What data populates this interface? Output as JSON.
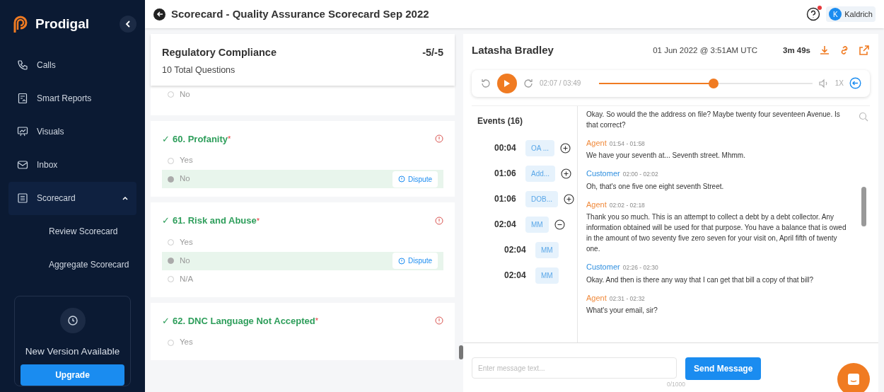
{
  "sidebar": {
    "brand": "Prodigal",
    "items": [
      {
        "kind": "phone",
        "label": "Calls",
        "selected": false
      },
      {
        "kind": "report",
        "label": "Smart Reports",
        "selected": false
      },
      {
        "kind": "chart",
        "label": "Visuals",
        "selected": false
      },
      {
        "kind": "mail",
        "label": "Inbox",
        "selected": false
      },
      {
        "kind": "list",
        "label": "Scorecard",
        "selected": true,
        "expanded": true,
        "children": [
          {
            "label": "Review Scorecard"
          },
          {
            "label": "Aggregate Scorecard"
          }
        ]
      }
    ],
    "update": {
      "text": "New Version Available",
      "button": "Upgrade"
    }
  },
  "topbar": {
    "title": "Scorecard - Quality Assurance Scorecard Sep 2022",
    "user": {
      "initial": "K",
      "name": "Kaldrich"
    },
    "help_notification": true
  },
  "section": {
    "title": "Regulatory Compliance",
    "subtitle": "10 Total Questions",
    "score": "-5/-5"
  },
  "questions": [
    {
      "options": [
        {
          "label": "No",
          "selected": false
        }
      ]
    },
    {
      "title": "60. Profanity",
      "check_mark": "✓",
      "required_mark": "*",
      "options": [
        {
          "label": "Yes",
          "selected": false
        },
        {
          "label": "No",
          "selected": true,
          "action": "Dispute"
        }
      ]
    },
    {
      "title": "61. Risk and Abuse",
      "check_mark": "✓",
      "required_mark": "*",
      "options": [
        {
          "label": "Yes",
          "selected": false
        },
        {
          "label": "No",
          "selected": true,
          "action": "Dispute"
        },
        {
          "label": "N/A",
          "selected": false
        }
      ]
    },
    {
      "title": "62. DNC Language Not Accepted",
      "check_mark": "✓",
      "required_mark": "*",
      "options": [
        {
          "label": "Yes",
          "selected": false
        }
      ]
    }
  ],
  "call": {
    "name": "Latasha Bradley",
    "date": "01 Jun 2022 @ 3:51AM UTC",
    "duration": "3m 49s"
  },
  "player": {
    "time": "02:07 / 03:49",
    "level": 0.54,
    "speed": "1X"
  },
  "events": {
    "title": "Events (16)",
    "items": [
      {
        "time": "00:04",
        "tag": "OA ...",
        "expanded": false
      },
      {
        "time": "01:06",
        "tag": "Add...",
        "expanded": false
      },
      {
        "time": "01:06",
        "tag": "DOB...",
        "expanded": false
      },
      {
        "time": "02:04",
        "tag": "MM",
        "expanded": true,
        "children": [
          {
            "time": "02:04",
            "tag": "MM"
          },
          {
            "time": "02:04",
            "tag": "MM"
          }
        ]
      }
    ]
  },
  "transcript": [
    {
      "text": "Okay. So would the the address on file? Maybe twenty four seventeen Avenue. Is that correct?"
    },
    {
      "speaker": "Agent",
      "kind": "agent",
      "time": "01:54 - 01:58",
      "text": "We have your seventh at... Seventh street. Mhmm."
    },
    {
      "speaker": "Customer",
      "kind": "customer",
      "time": "02:00 - 02:02",
      "text": "Oh, that's one five one eight seventh Street."
    },
    {
      "speaker": "Agent",
      "kind": "agent",
      "time": "02:02 - 02:18",
      "text": "Thank you so much. This is an attempt to collect a debt by a debt collector. Any information obtained will be used for that purpose. You have a balance that is owed in the amount of two seventy five zero seven for your visit on, April fifth of twenty one."
    },
    {
      "speaker": "Customer",
      "kind": "customer",
      "time": "02:26 - 02:30",
      "text": "Okay. And then is there any way that I can get that bill a copy of that bill?"
    },
    {
      "speaker": "Agent",
      "kind": "agent",
      "time": "02:31 - 02:32",
      "text": "What's your email, sir?"
    }
  ],
  "message": {
    "placeholder": "Enter message text...",
    "counter": "0/1000",
    "button": "Send Message"
  }
}
